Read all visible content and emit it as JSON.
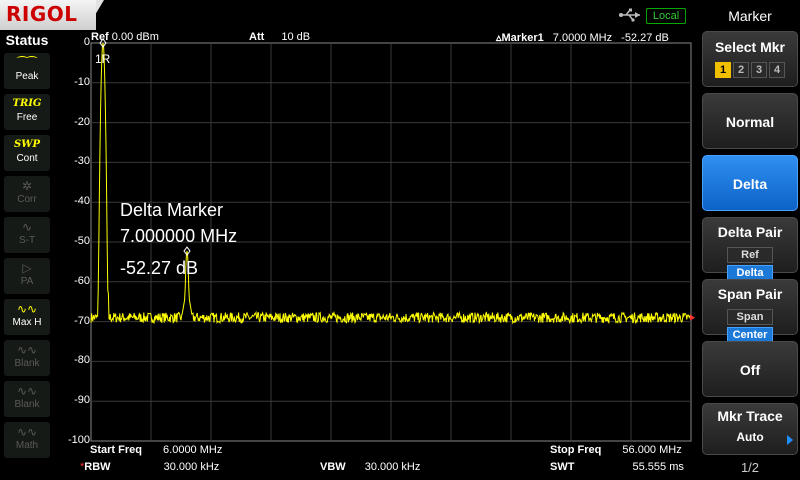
{
  "brand": "RIGOL",
  "remote_status": "Local",
  "status_panel": {
    "title": "Status",
    "items": [
      {
        "icon": "peak-detector-icon",
        "label": "Peak",
        "state": "on"
      },
      {
        "icon": "trig-icon",
        "top": "TRIG",
        "label": "Free",
        "state": "on"
      },
      {
        "icon": "swp-icon",
        "top": "SWP",
        "label": "Cont",
        "state": "on"
      },
      {
        "icon": "correction-icon",
        "label": "Corr",
        "state": "off"
      },
      {
        "icon": "source-tracking-icon",
        "label": "S-T",
        "state": "off"
      },
      {
        "icon": "preamp-icon",
        "label": "PA",
        "state": "off"
      },
      {
        "icon": "trace-maxhold-icon",
        "label": "Max H",
        "state": "on"
      },
      {
        "icon": "trace-blank-icon",
        "label": "Blank",
        "state": "off"
      },
      {
        "icon": "trace-blank-icon",
        "label": "Blank",
        "state": "off"
      },
      {
        "icon": "trace-math-icon",
        "label": "Math",
        "state": "off"
      }
    ]
  },
  "header": {
    "ref_label": "Ref",
    "ref_value": "0.00 dBm",
    "att_label": "Att",
    "att_value": "10 dB",
    "marker_label": "▵Marker1",
    "marker_freq": "7.0000 MHz",
    "marker_level": "-52.27 dB"
  },
  "y_axis": {
    "ticks": [
      "0",
      "-10",
      "-20",
      "-30",
      "-40",
      "-50",
      "-60",
      "-70",
      "-80",
      "-90",
      "-100"
    ]
  },
  "marker_tag": "1R",
  "delta_readout": {
    "title": "Delta Marker",
    "freq": "7.000000 MHz",
    "level": "-52.27 dB"
  },
  "footer": {
    "start_label": "Start Freq",
    "start_value": "6.0000 MHz",
    "stop_label": "Stop Freq",
    "stop_value": "56.000 MHz",
    "rbw_label": "RBW",
    "rbw_value": "30.000 kHz",
    "vbw_label": "VBW",
    "vbw_value": "30.000 kHz",
    "swt_label": "SWT",
    "swt_value": "55.555 ms"
  },
  "menu": {
    "title": "Marker",
    "select_mkr_label": "Select Mkr",
    "markers": [
      "1",
      "2",
      "3",
      "4"
    ],
    "selected_marker": "1",
    "normal_label": "Normal",
    "delta_label": "Delta",
    "delta_pair_label": "Delta Pair",
    "delta_pair_options": [
      "Ref",
      "Delta"
    ],
    "span_pair_label": "Span Pair",
    "span_pair_options": [
      "Span",
      "Center"
    ],
    "off_label": "Off",
    "mkr_trace_label": "Mkr Trace",
    "mkr_trace_value": "Auto",
    "page": "1/2"
  },
  "colors": {
    "trace": "#ffff00",
    "active_key": "#1d79d8",
    "logo_red": "#cc0000"
  },
  "chart_data": {
    "type": "line",
    "x_range_mhz": [
      6.0,
      56.0
    ],
    "ylim": [
      -100,
      0
    ],
    "grid": true,
    "noise_floor_db": -69,
    "peaks": [
      {
        "freq_mhz": 7.0,
        "level_db": 0
      },
      {
        "freq_mhz": 14.0,
        "level_db": -52.27
      }
    ]
  }
}
